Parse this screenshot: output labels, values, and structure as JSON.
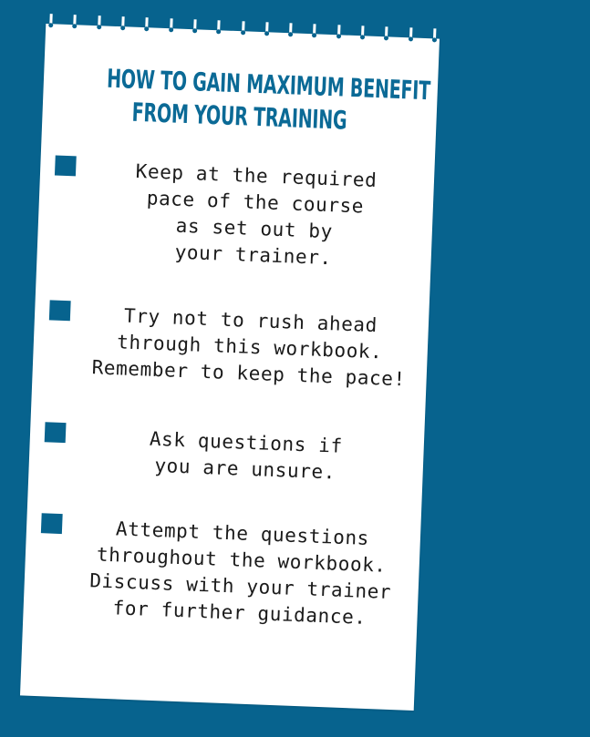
{
  "title_lines": [
    "HOW TO GAIN MAXIMUM BENEFIT",
    "FROM YOUR TRAINING"
  ],
  "tips": [
    {
      "text": "Keep at the required\npace of the course\nas set out by\nyour trainer."
    },
    {
      "text": "Try not to rush ahead\nthrough this workbook.\nRemember to keep the pace!"
    },
    {
      "text": "Ask questions if\nyou are unsure."
    },
    {
      "text": "Attempt the questions\nthroughout the workbook.\nDiscuss with your trainer\nfor further guidance."
    }
  ],
  "colors": {
    "background": "#07638e",
    "title": "#0b6a96",
    "bullet": "#07638e",
    "paper": "#ffffff",
    "text": "#1a1a1a"
  }
}
